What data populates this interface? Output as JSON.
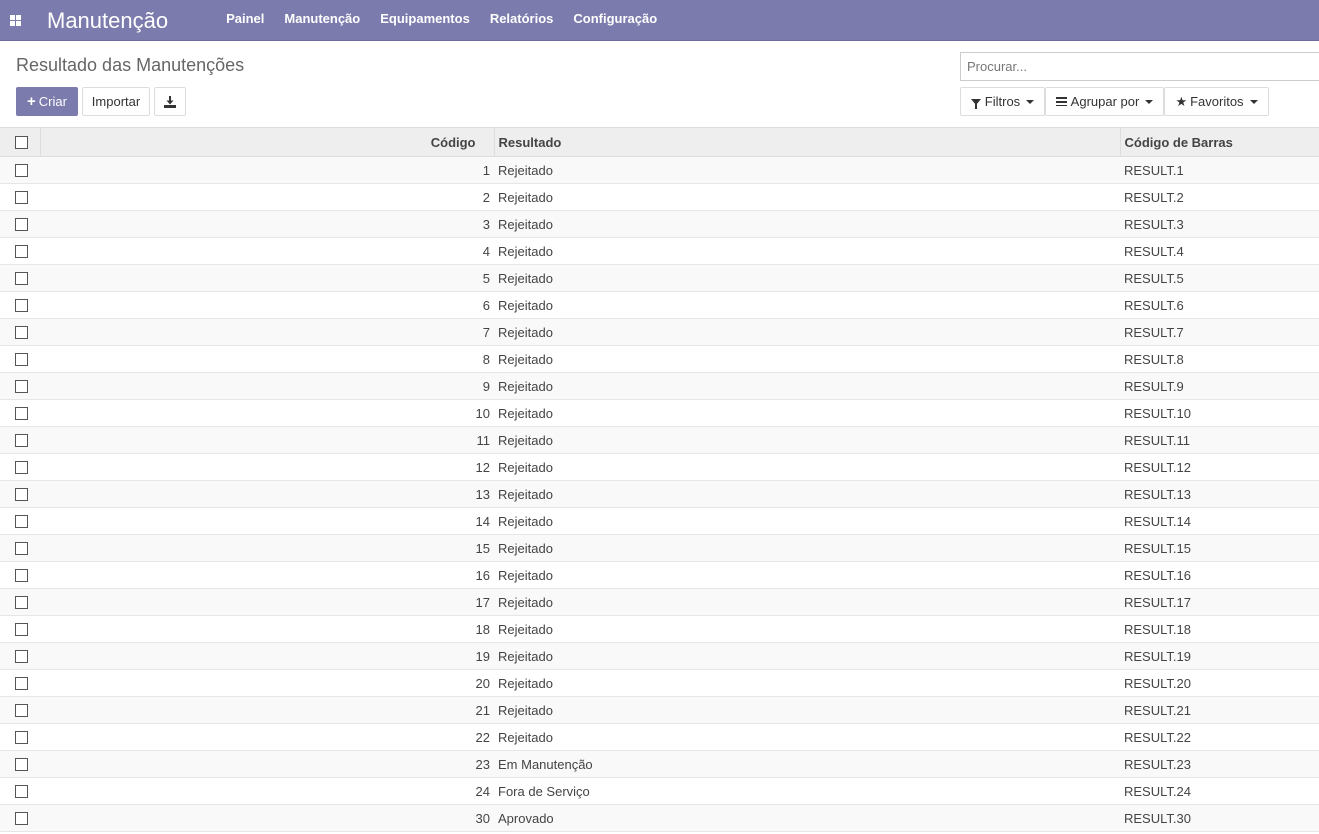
{
  "navbar": {
    "brand": "Manutenção",
    "menu": [
      "Painel",
      "Manutenção",
      "Equipamentos",
      "Relatórios",
      "Configuração"
    ]
  },
  "control_panel": {
    "breadcrumb": "Resultado das Manutenções",
    "create_label": "Criar",
    "import_label": "Importar",
    "search_placeholder": "Procurar...",
    "filters_label": "Filtros",
    "groupby_label": "Agrupar por",
    "favorites_label": "Favoritos"
  },
  "table": {
    "columns": [
      "Código",
      "Resultado",
      "Código de Barras"
    ],
    "rows": [
      {
        "code": "1",
        "result": "Rejeitado",
        "barcode": "RESULT.1"
      },
      {
        "code": "2",
        "result": "Rejeitado",
        "barcode": "RESULT.2"
      },
      {
        "code": "3",
        "result": "Rejeitado",
        "barcode": "RESULT.3"
      },
      {
        "code": "4",
        "result": "Rejeitado",
        "barcode": "RESULT.4"
      },
      {
        "code": "5",
        "result": "Rejeitado",
        "barcode": "RESULT.5"
      },
      {
        "code": "6",
        "result": "Rejeitado",
        "barcode": "RESULT.6"
      },
      {
        "code": "7",
        "result": "Rejeitado",
        "barcode": "RESULT.7"
      },
      {
        "code": "8",
        "result": "Rejeitado",
        "barcode": "RESULT.8"
      },
      {
        "code": "9",
        "result": "Rejeitado",
        "barcode": "RESULT.9"
      },
      {
        "code": "10",
        "result": "Rejeitado",
        "barcode": "RESULT.10"
      },
      {
        "code": "11",
        "result": "Rejeitado",
        "barcode": "RESULT.11"
      },
      {
        "code": "12",
        "result": "Rejeitado",
        "barcode": "RESULT.12"
      },
      {
        "code": "13",
        "result": "Rejeitado",
        "barcode": "RESULT.13"
      },
      {
        "code": "14",
        "result": "Rejeitado",
        "barcode": "RESULT.14"
      },
      {
        "code": "15",
        "result": "Rejeitado",
        "barcode": "RESULT.15"
      },
      {
        "code": "16",
        "result": "Rejeitado",
        "barcode": "RESULT.16"
      },
      {
        "code": "17",
        "result": "Rejeitado",
        "barcode": "RESULT.17"
      },
      {
        "code": "18",
        "result": "Rejeitado",
        "barcode": "RESULT.18"
      },
      {
        "code": "19",
        "result": "Rejeitado",
        "barcode": "RESULT.19"
      },
      {
        "code": "20",
        "result": "Rejeitado",
        "barcode": "RESULT.20"
      },
      {
        "code": "21",
        "result": "Rejeitado",
        "barcode": "RESULT.21"
      },
      {
        "code": "22",
        "result": "Rejeitado",
        "barcode": "RESULT.22"
      },
      {
        "code": "23",
        "result": "Em Manutenção",
        "barcode": "RESULT.23"
      },
      {
        "code": "24",
        "result": "Fora de Serviço",
        "barcode": "RESULT.24"
      },
      {
        "code": "30",
        "result": "Aprovado",
        "barcode": "RESULT.30"
      }
    ]
  },
  "colors": {
    "navbar": "#7c7bad",
    "primary_button": "#7c7bad"
  }
}
